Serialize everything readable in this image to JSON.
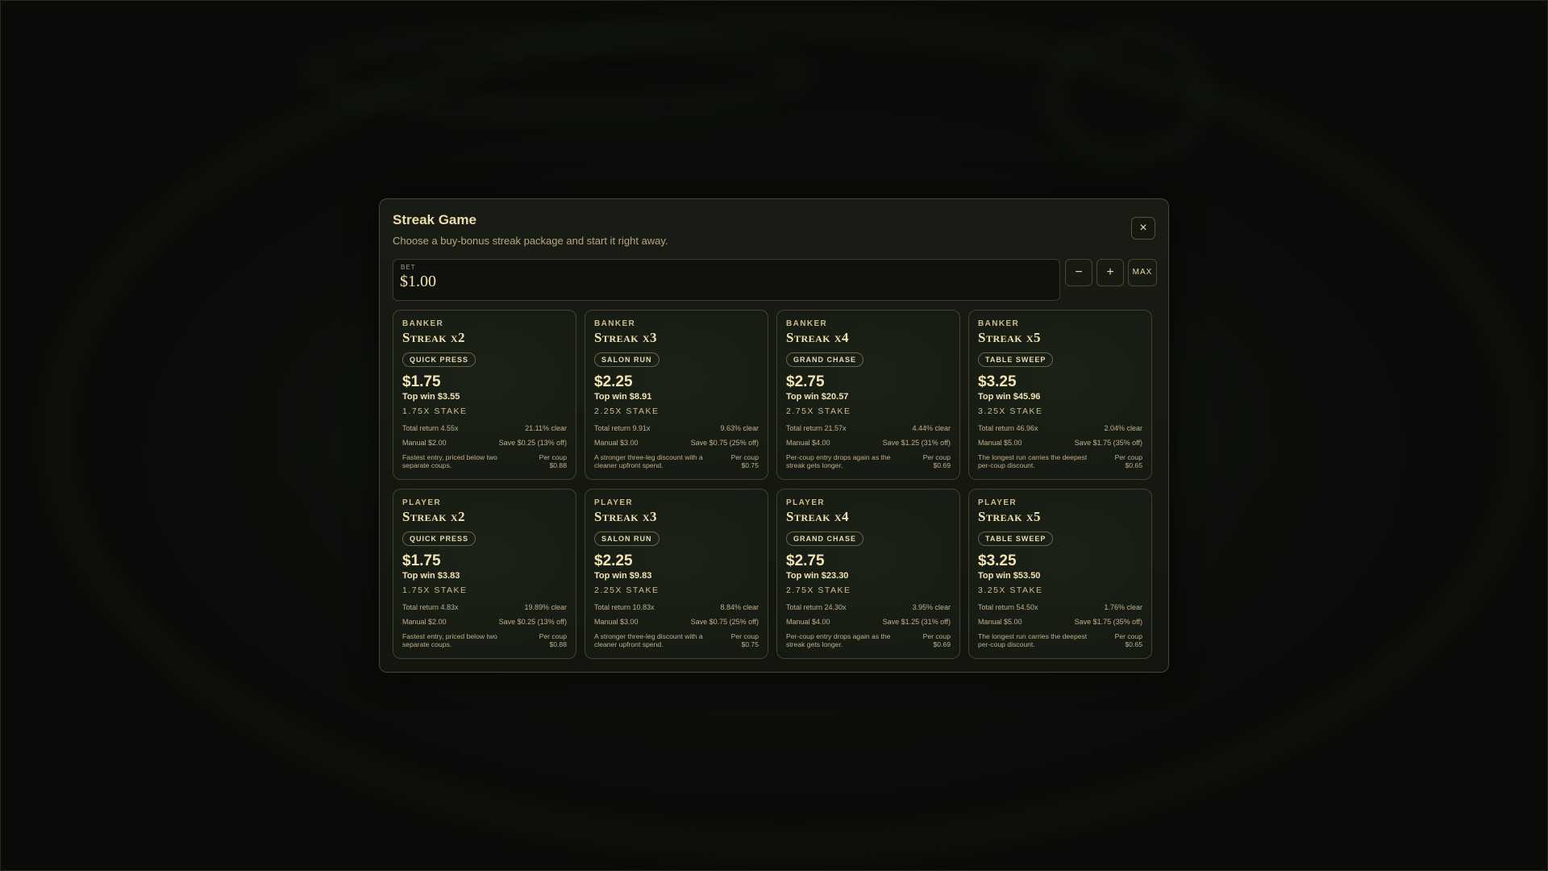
{
  "modal": {
    "title": "Streak Game",
    "subtitle": "Choose a buy-bonus streak package and start it right away.",
    "close_label": "×"
  },
  "bet": {
    "label": "BET",
    "value": "$1.00",
    "minus_label": "−",
    "plus_label": "+",
    "max_label": "MAX"
  },
  "cards": [
    {
      "side": "BANKER",
      "name": "Streak x2",
      "tag": "QUICK PRESS",
      "price": "$1.75",
      "top_win": "Top win $3.55",
      "stake": "1.75X STAKE",
      "total_return": "Total return 4.55x",
      "clear": "21.11% clear",
      "manual": "Manual $2.00",
      "save": "Save $0.25 (13% off)",
      "desc": "Fastest entry, priced below two separate coups.",
      "per_coup_label": "Per coup",
      "per_coup": "$0.88"
    },
    {
      "side": "BANKER",
      "name": "Streak x3",
      "tag": "SALON RUN",
      "price": "$2.25",
      "top_win": "Top win $8.91",
      "stake": "2.25X STAKE",
      "total_return": "Total return 9.91x",
      "clear": "9.63% clear",
      "manual": "Manual $3.00",
      "save": "Save $0.75 (25% off)",
      "desc": "A stronger three-leg discount with a cleaner upfront spend.",
      "per_coup_label": "Per coup",
      "per_coup": "$0.75"
    },
    {
      "side": "BANKER",
      "name": "Streak x4",
      "tag": "GRAND CHASE",
      "price": "$2.75",
      "top_win": "Top win $20.57",
      "stake": "2.75X STAKE",
      "total_return": "Total return 21.57x",
      "clear": "4.44% clear",
      "manual": "Manual $4.00",
      "save": "Save $1.25 (31% off)",
      "desc": "Per-coup entry drops again as the streak gets longer.",
      "per_coup_label": "Per coup",
      "per_coup": "$0.69"
    },
    {
      "side": "BANKER",
      "name": "Streak x5",
      "tag": "TABLE SWEEP",
      "price": "$3.25",
      "top_win": "Top win $45.96",
      "stake": "3.25X STAKE",
      "total_return": "Total return 46.96x",
      "clear": "2.04% clear",
      "manual": "Manual $5.00",
      "save": "Save $1.75 (35% off)",
      "desc": "The longest run carries the deepest per-coup discount.",
      "per_coup_label": "Per coup",
      "per_coup": "$0.65"
    },
    {
      "side": "PLAYER",
      "name": "Streak x2",
      "tag": "QUICK PRESS",
      "price": "$1.75",
      "top_win": "Top win $3.83",
      "stake": "1.75X STAKE",
      "total_return": "Total return 4.83x",
      "clear": "19.89% clear",
      "manual": "Manual $2.00",
      "save": "Save $0.25 (13% off)",
      "desc": "Fastest entry, priced below two separate coups.",
      "per_coup_label": "Per coup",
      "per_coup": "$0.88"
    },
    {
      "side": "PLAYER",
      "name": "Streak x3",
      "tag": "SALON RUN",
      "price": "$2.25",
      "top_win": "Top win $9.83",
      "stake": "2.25X STAKE",
      "total_return": "Total return 10.83x",
      "clear": "8.84% clear",
      "manual": "Manual $3.00",
      "save": "Save $0.75 (25% off)",
      "desc": "A stronger three-leg discount with a cleaner upfront spend.",
      "per_coup_label": "Per coup",
      "per_coup": "$0.75"
    },
    {
      "side": "PLAYER",
      "name": "Streak x4",
      "tag": "GRAND CHASE",
      "price": "$2.75",
      "top_win": "Top win $23.30",
      "stake": "2.75X STAKE",
      "total_return": "Total return 24.30x",
      "clear": "3.95% clear",
      "manual": "Manual $4.00",
      "save": "Save $1.25 (31% off)",
      "desc": "Per-coup entry drops again as the streak gets longer.",
      "per_coup_label": "Per coup",
      "per_coup": "$0.69"
    },
    {
      "side": "PLAYER",
      "name": "Streak x5",
      "tag": "TABLE SWEEP",
      "price": "$3.25",
      "top_win": "Top win $53.50",
      "stake": "3.25X STAKE",
      "total_return": "Total return 54.50x",
      "clear": "1.76% clear",
      "manual": "Manual $5.00",
      "save": "Save $1.75 (35% off)",
      "desc": "The longest run carries the deepest per-coup discount.",
      "per_coup_label": "Per coup",
      "per_coup": "$0.65"
    }
  ]
}
